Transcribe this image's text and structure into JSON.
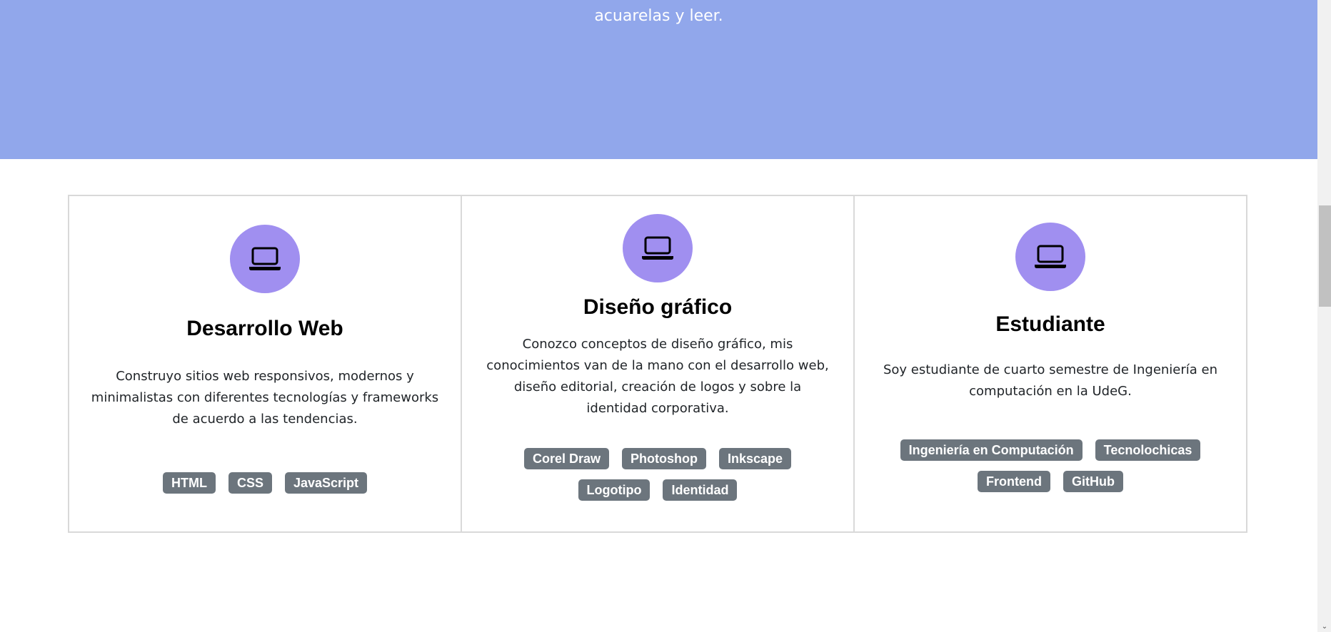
{
  "hero": {
    "text": "acuarelas y leer."
  },
  "cards": [
    {
      "icon": "laptop-icon",
      "title": "Desarrollo Web",
      "text": "Construyo sitios web responsivos, modernos y minimalistas con diferentes tecnologías y frameworks de acuerdo a las tendencias.",
      "tags": [
        "HTML",
        "CSS",
        "JavaScript"
      ]
    },
    {
      "icon": "laptop-icon",
      "title": "Diseño gráfico",
      "text": "Conozco conceptos de diseño gráfico, mis conocimientos van de la mano con el desarrollo web, diseño editorial, creación de logos y sobre la identidad corporativa.",
      "tags": [
        "Corel Draw",
        "Photoshop",
        "Inkscape",
        "Logotipo",
        "Identidad"
      ]
    },
    {
      "icon": "laptop-icon",
      "title": "Estudiante",
      "text": "Soy estudiante de cuarto semestre de Ingeniería en computación en la UdeG.",
      "tags": [
        "Ingeniería en Computación",
        "Tecnolochicas",
        "Frontend",
        "GitHub"
      ]
    }
  ],
  "colors": {
    "hero_background": "#91a7eb",
    "icon_circle": "#a08ff0",
    "badge_background": "#6c757d",
    "card_border": "#d9d9d9"
  }
}
